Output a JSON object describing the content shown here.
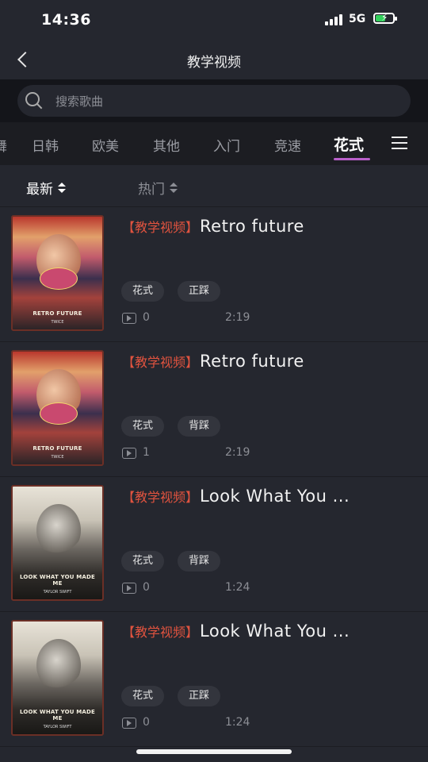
{
  "status_bar": {
    "time": "14:36",
    "network": "5G"
  },
  "nav": {
    "title": "教学视频"
  },
  "search": {
    "placeholder": "搜索歌曲"
  },
  "tabs": [
    {
      "label": "舞"
    },
    {
      "label": "日韩"
    },
    {
      "label": "欧美"
    },
    {
      "label": "其他"
    },
    {
      "label": "入门"
    },
    {
      "label": "竞速"
    },
    {
      "label": "花式",
      "active": true
    }
  ],
  "sort": {
    "latest": "最新",
    "hot": "热门"
  },
  "videos": [
    {
      "category": "【教学视频】",
      "title": "Retro future",
      "tags": [
        "花式",
        "正踩"
      ],
      "plays": "0",
      "duration": "2:19",
      "cover": {
        "title": "RETRO FUTURE",
        "subtitle": "TWICE"
      }
    },
    {
      "category": "【教学视频】",
      "title": "Retro future",
      "tags": [
        "花式",
        "背踩"
      ],
      "plays": "1",
      "duration": "2:19",
      "cover": {
        "title": "RETRO FUTURE",
        "subtitle": "TWICE"
      }
    },
    {
      "category": "【教学视频】",
      "title": "Look What You ...",
      "tags": [
        "花式",
        "背踩"
      ],
      "plays": "0",
      "duration": "1:24",
      "cover": {
        "title": "LOOK WHAT YOU MADE ME",
        "subtitle": "TAYLOR SWIFT"
      }
    },
    {
      "category": "【教学视频】",
      "title": "Look What You ...",
      "tags": [
        "花式",
        "正踩"
      ],
      "plays": "0",
      "duration": "1:24",
      "cover": {
        "title": "LOOK WHAT YOU MADE ME",
        "subtitle": "TAYLOR SWIFT"
      }
    }
  ],
  "colors": {
    "accent_underline": "#b85fc9",
    "category_red": "#e0533f",
    "background": "#25272f"
  }
}
